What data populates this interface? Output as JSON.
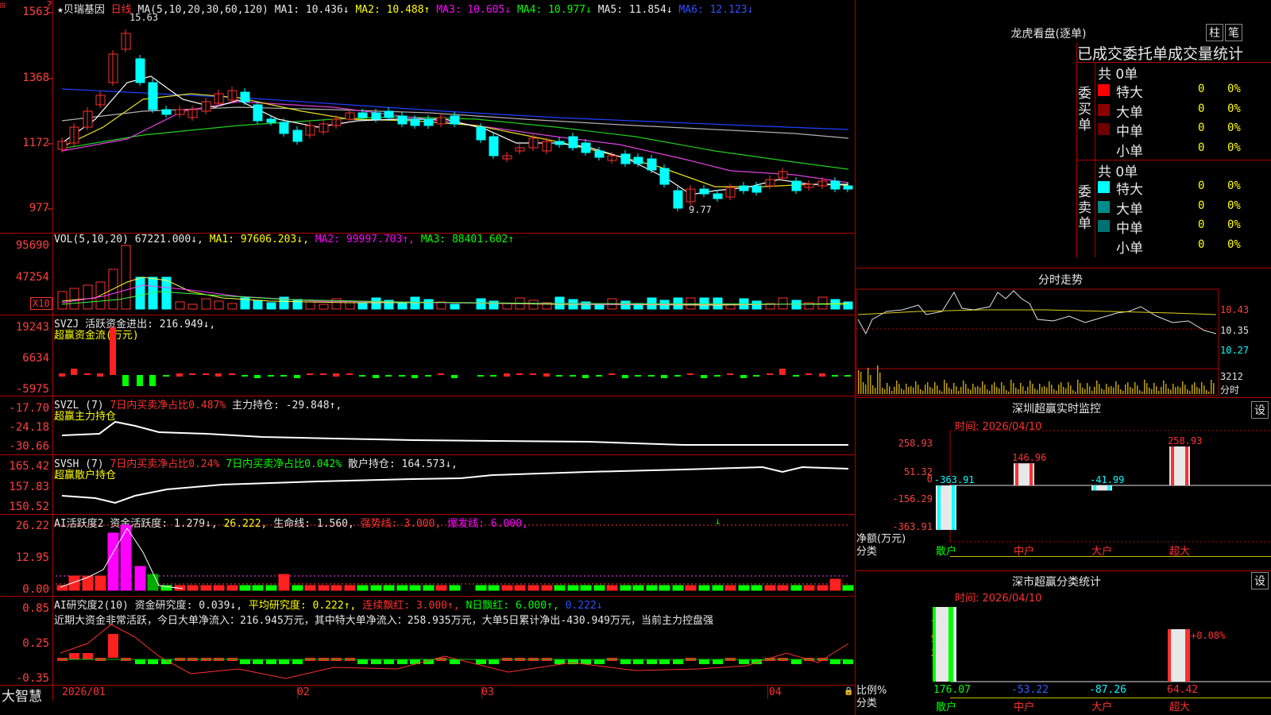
{
  "stock": {
    "star": "★",
    "name": "贝瑞基因",
    "period": "日线",
    "ma_label": "MA(5,10,20,30,60,120)"
  },
  "price_ma": {
    "ma1": "MA1: 10.436↓",
    "ma2": "MA2: 10.488↑",
    "ma3": "MA3: 10.605↓",
    "ma4": "MA4: 10.977↓",
    "ma5": "MA5: 11.854↓",
    "ma6": "MA6: 12.123↓"
  },
  "price_axis": [
    "1563",
    "1368",
    "1172",
    "977"
  ],
  "price_marks": {
    "high": "15.63",
    "low": "9.77"
  },
  "vol": {
    "label": "VOL(5,10,20)",
    "value": "67221.000↓",
    "ma1": "MA1: 97606.203↓",
    "ma2": "MA2: 99997.703↑",
    "ma3": "MA3: 88401.602↑",
    "axis": [
      "95690",
      "47254"
    ],
    "unit": "X10"
  },
  "svzj": {
    "label": "SVZJ",
    "text": "活跃资金进出: 216.949↓,",
    "sub": "超赢资金流(万元)",
    "axis": [
      "19243",
      "6634",
      "-5975"
    ]
  },
  "svzl": {
    "label": "SVZL (7)",
    "pct": "7日内买卖净占比0.487%",
    "main": "主力持仓: -29.848↑,",
    "sub": "超赢主力持仓",
    "axis": [
      "-17.70",
      "-24.18",
      "-30.66"
    ]
  },
  "svsh": {
    "label": "SVSH (7)",
    "pct1": "7日内买卖净占比0.24%",
    "pct2": "7日内买卖净占比0.042%",
    "main": "散户持仓: 164.573↓,",
    "sub": "超赢散户持仓",
    "axis": [
      "165.42",
      "157.83",
      "150.52"
    ]
  },
  "ai1": {
    "label": "AI活跃度2",
    "t1": "资金活跃度: 1.279↓,",
    "t2": "26.222,",
    "t3": "生命线: 1.560,",
    "t4": "强势线: 3.000,",
    "t5": "爆发线: 6.000,",
    "axis": [
      "26.22",
      "12.95",
      "0.00"
    ]
  },
  "ai2": {
    "label": "AI研究度2(10)",
    "t1": "资金研究度: 0.039↓,",
    "t2": "平均研究度: 0.222↑,",
    "t3": "连续飘红: 3.000↑,",
    "t4": "N日飘红: 6.000↑,",
    "t5": "0.222↓",
    "comment": "近期大资金非常活跃，今日大单净流入：216.945万元，其中特大单净流入：258.935万元，大单5日累计净出-430.949万元，当前主力控盘强",
    "axis": [
      "0.85",
      "0.25",
      "-0.35"
    ]
  },
  "dates": [
    "2026/01",
    "02",
    "03",
    "04"
  ],
  "footer_brand": "大智慧",
  "lhb": {
    "title": "龙虎看盘(逐单)",
    "btn1": "柱",
    "btn2": "笔",
    "header": "已成交委托单成交量统计",
    "buy_label": "委买单",
    "sell_label": "委卖单",
    "buy_total": "共 0单",
    "sell_total": "共 0单",
    "buy_rows": [
      {
        "name": "特大",
        "n": "0",
        "p": "0%",
        "color": "#ff0000"
      },
      {
        "name": "大单",
        "n": "0",
        "p": "0%",
        "color": "#8b0000"
      },
      {
        "name": "中单",
        "n": "0",
        "p": "0%",
        "color": "#6e0000"
      },
      {
        "name": "小单",
        "n": "0",
        "p": "0%",
        "color": "#000000"
      }
    ],
    "sell_rows": [
      {
        "name": "特大",
        "n": "0",
        "p": "0%",
        "color": "#00ffff"
      },
      {
        "name": "大单",
        "n": "0",
        "p": "0%",
        "color": "#008b8b"
      },
      {
        "name": "中单",
        "n": "0",
        "p": "0%",
        "color": "#007070"
      },
      {
        "name": "小单",
        "n": "0",
        "p": "0%",
        "color": "#000000"
      }
    ]
  },
  "intraday": {
    "title": "分时走势",
    "axis": [
      "10.43",
      "10.35",
      "10.27"
    ],
    "vol": "3212",
    "vol_unit": "分时"
  },
  "monitor": {
    "title": "深圳超赢实时监控",
    "btn": "设",
    "date": "时间: 2026/04/10",
    "axis": [
      "258.93",
      "51.32",
      "0",
      "-156.29",
      "-363.91"
    ],
    "ylabel": "净额(万元)",
    "xlabel": "分类",
    "cats": [
      "散户",
      "中户",
      "大户",
      "超大"
    ],
    "values": [
      "-363.91",
      "146.96",
      "-41.99",
      "258.93"
    ]
  },
  "stats": {
    "title": "深市超赢分类统计",
    "btn": "设",
    "date": "时间: 2026/04/10",
    "axis": [
      "75",
      "50",
      "25",
      "0"
    ],
    "ylabel": "比例%",
    "xlabel": "分类",
    "cats": [
      "散户",
      "中户",
      "大户",
      "超大"
    ],
    "values": [
      "176.07",
      "-53.22",
      "-87.26",
      "64.42"
    ],
    "top_label": "+0.08%"
  },
  "chart_data": {
    "type": "bar",
    "title": "深圳超赢实时监控",
    "ylabel": "净额(万元)",
    "xlabel": "分类",
    "categories": [
      "散户",
      "中户",
      "大户",
      "超大"
    ],
    "values": [
      -363.91,
      146.96,
      -41.99,
      258.93
    ],
    "ylim": [
      -363.91,
      258.93
    ]
  }
}
